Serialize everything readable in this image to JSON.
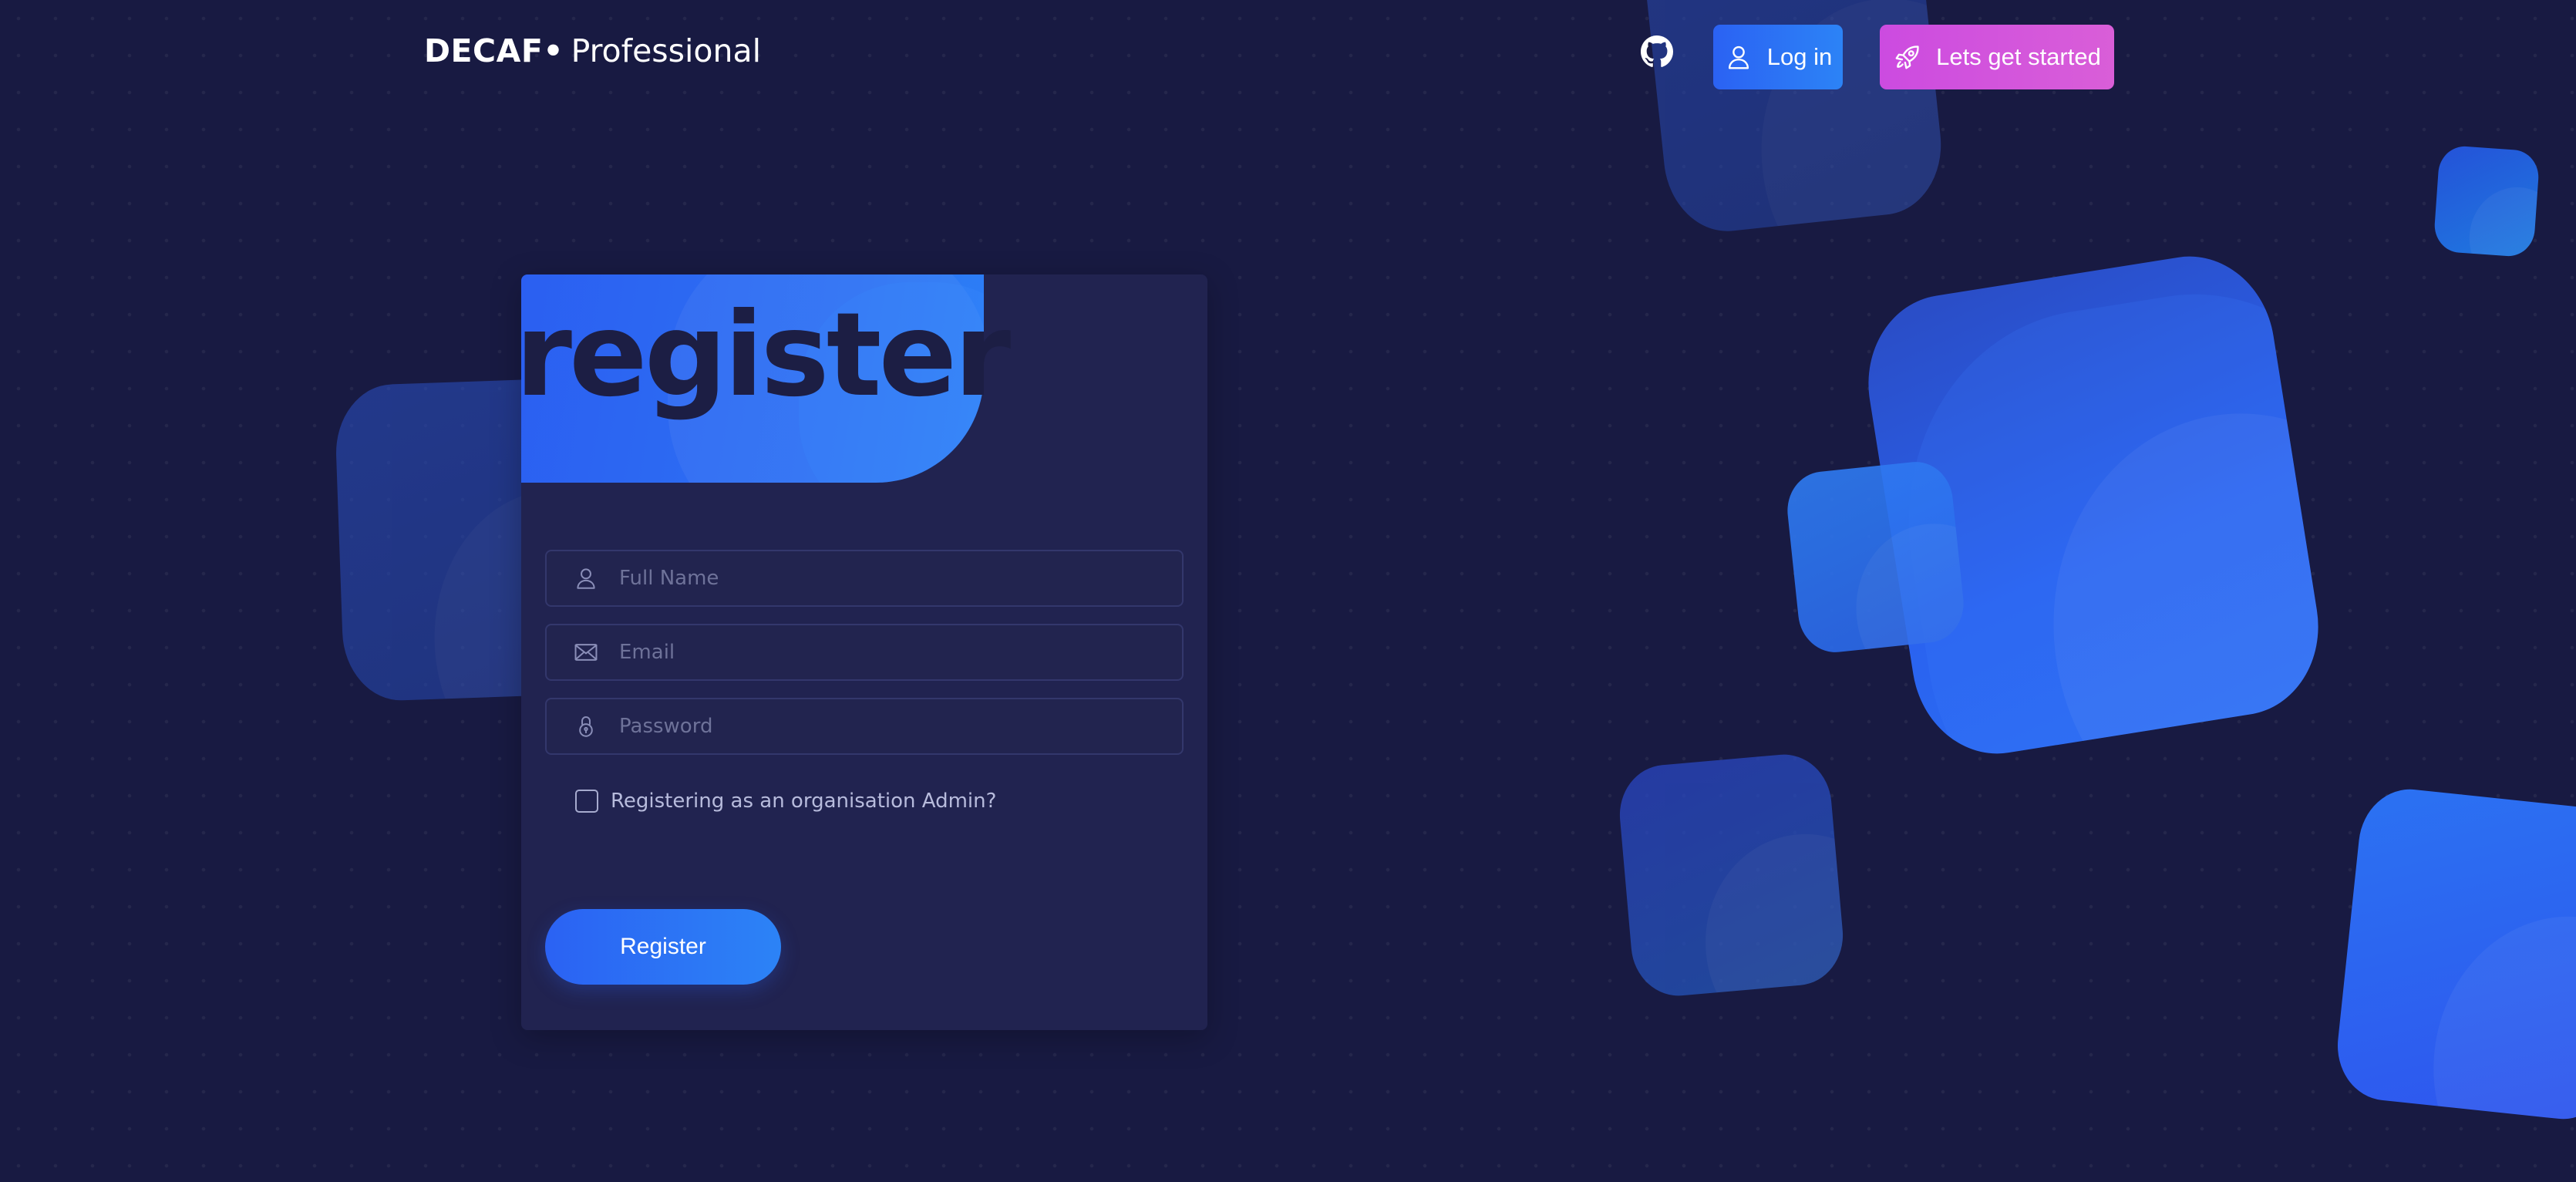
{
  "header": {
    "brand_strong": "DECAF",
    "brand_dot": "•",
    "brand_light": "Professional",
    "github_icon": "github-icon",
    "login_label": "Log in",
    "login_icon": "user-icon",
    "start_label": "Lets get started",
    "start_icon": "rocket-icon"
  },
  "form": {
    "title": "register",
    "fullname_placeholder": "Full Name",
    "email_placeholder": "Email",
    "password_placeholder": "Password",
    "admin_label": "Registering as an organisation Admin?",
    "admin_checked": false,
    "submit_label": "Register"
  },
  "colors": {
    "background": "#181a42",
    "card": "#212350",
    "accent_blue": "#2b62f3",
    "accent_pink": "#cc4be0",
    "title_text": "#1c1e44"
  }
}
